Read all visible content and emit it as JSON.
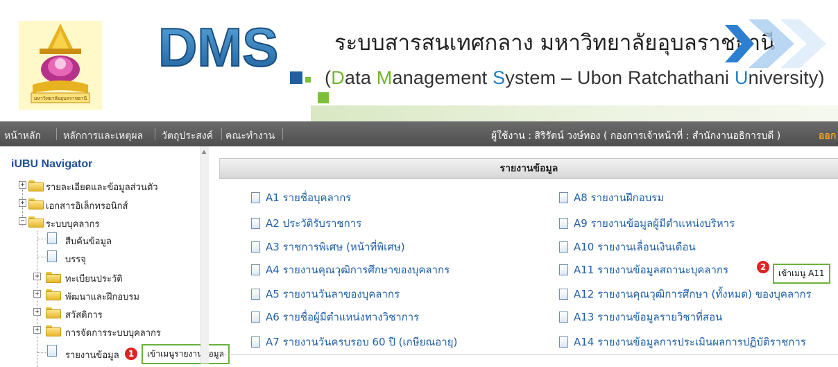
{
  "header": {
    "title_th": "ระบบสารสนเทศกลาง มหาวิทยาลัยอุบลราชธานี",
    "title_en": {
      "open": "(",
      "d": "D",
      "ata": "ata ",
      "m": "M",
      "anagement": "anagement ",
      "s": "S",
      "ystem": "ystem – Ubon Ratchathani ",
      "u": "U",
      "niversity": "niversity)"
    },
    "logo_text": "DMS",
    "seal_text": "มหาวิทยาลัยอุบลราชธานี"
  },
  "menu": {
    "items": [
      "หน้าหลัก",
      "หลักการและเหตุผล",
      "วัตถุประสงค์",
      "คณะทำงาน"
    ],
    "user": "ผู้ใช้งาน : สิริรัตน์ วงษ์ทอง ( กองการเจ้าหน้าที่ : สำนักงานอธิการบดี )",
    "logout": "ออก"
  },
  "nav": {
    "title": "iUBU Navigator",
    "nodes": [
      "รายละเอียดและข้อมูลส่วนตัว",
      "เอกสารอิเล็กทรอนิกส์",
      "ระบบบุคลากร",
      "สืบค้นข้อมูล",
      "บรรจุ",
      "ทะเบียนประวัติ",
      "พัฒนาและฝึกอบรม",
      "สวัสดิการ",
      "การจัดการระบบบุคลากร",
      "รายงานข้อมูล"
    ]
  },
  "annotations": {
    "badge1": "1",
    "callout1": "เข้าเมนูรายงานข้อมูล",
    "badge2": "2",
    "callout2": "เข้าเมนู A11"
  },
  "main": {
    "title": "รายงานข้อมูล",
    "reports_left": [
      "A1 รายชื่อบุคลากร",
      "A2 ประวัติรับราชการ",
      "A3 ราชการพิเศษ (หน้าที่พิเศษ)",
      "A4 รายงานคุณวุฒิการศึกษาของบุคลากร",
      "A5 รายงานวันลาของบุคลากร",
      "A6 รายชื่อผู้มีตำแหน่งทางวิชาการ",
      "A7 รายงานวันครบรอบ 60 ปี (เกษียณอายุ)"
    ],
    "reports_right": [
      "A8 รายงานฝึกอบรม",
      "A9 รายงานข้อมูลผู้มีตำแหน่งบริหาร",
      "A10 รายงานเลื่อนเงินเดือน",
      "A11 รายงานข้อมูลสถานะบุคลากร",
      "A12 รายงานคุณวุฒิการศึกษา (ทั้งหมด) ของบุคลากร",
      "A13 รายงานข้อมูลรายวิชาที่สอน",
      "A14 รายงานข้อมูลการประเมินผลการปฏิบัติราชการ"
    ]
  },
  "colors": {
    "link": "#1f5fa8",
    "menubar": "#5a5a5a",
    "accent_green": "#6ab13c",
    "badge_red": "#e02424",
    "logout_orange": "#f3a21b"
  }
}
